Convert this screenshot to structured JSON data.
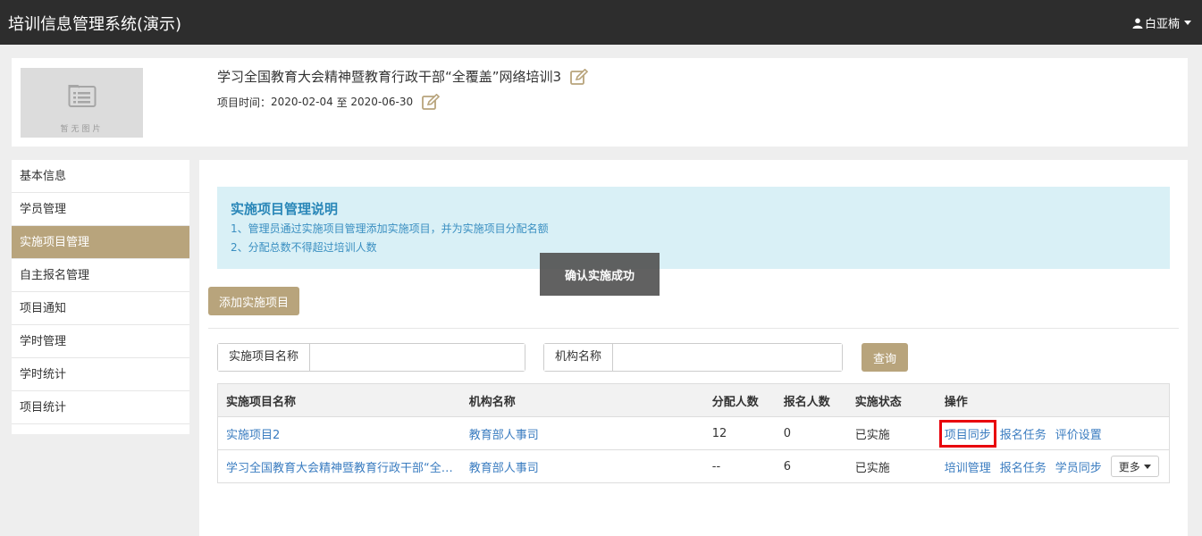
{
  "topbar": {
    "app_title": "培训信息管理系统(演示)",
    "user_name": "白亚楠",
    "user_icon": "user-icon"
  },
  "project": {
    "no_image_text": "暂无图片",
    "title": "学习全国教育大会精神暨教育行政干部“全覆盖”网络培训3",
    "time_label": "项目时间：",
    "start_date": "2020-02-04",
    "date_sep": " 至 ",
    "end_date": "2020-06-30"
  },
  "sidebar": {
    "items": [
      {
        "label": "基本信息"
      },
      {
        "label": "学员管理"
      },
      {
        "label": "实施项目管理"
      },
      {
        "label": "自主报名管理"
      },
      {
        "label": "项目通知"
      },
      {
        "label": "学时管理"
      },
      {
        "label": "学时统计"
      },
      {
        "label": "项目统计"
      }
    ],
    "active_index": 2
  },
  "notice": {
    "title": "实施项目管理说明",
    "line1": "1、管理员通过实施项目管理添加实施项目，并为实施项目分配名额",
    "line2": "2、分配总数不得超过培训人数"
  },
  "toast": "确认实施成功",
  "toolbar": {
    "add_label": "添加实施项目"
  },
  "search": {
    "name_label": "实施项目名称",
    "name_value": "",
    "org_label": "机构名称",
    "org_value": "",
    "query_label": "查询"
  },
  "table": {
    "headers": [
      "实施项目名称",
      "机构名称",
      "分配人数",
      "报名人数",
      "实施状态",
      "操作"
    ],
    "rows": [
      {
        "name": "实施项目2",
        "org": "教育部人事司",
        "allocated": "12",
        "registered": "0",
        "status": "已实施",
        "actions": [
          "项目同步",
          "报名任务",
          "评价设置"
        ]
      },
      {
        "name": "学习全国教育大会精神暨教育行政干部“全…",
        "org": "教育部人事司",
        "allocated": "--",
        "registered": "6",
        "status": "已实施",
        "actions": [
          "培训管理",
          "报名任务",
          "学员同步"
        ],
        "more_label": "更多"
      }
    ]
  },
  "colors": {
    "topbar_bg": "#2d2d2d",
    "accent": "#b8a47c",
    "link": "#3a7cc0",
    "notice_bg": "#d9f0f6",
    "highlight": "#e8000b"
  }
}
